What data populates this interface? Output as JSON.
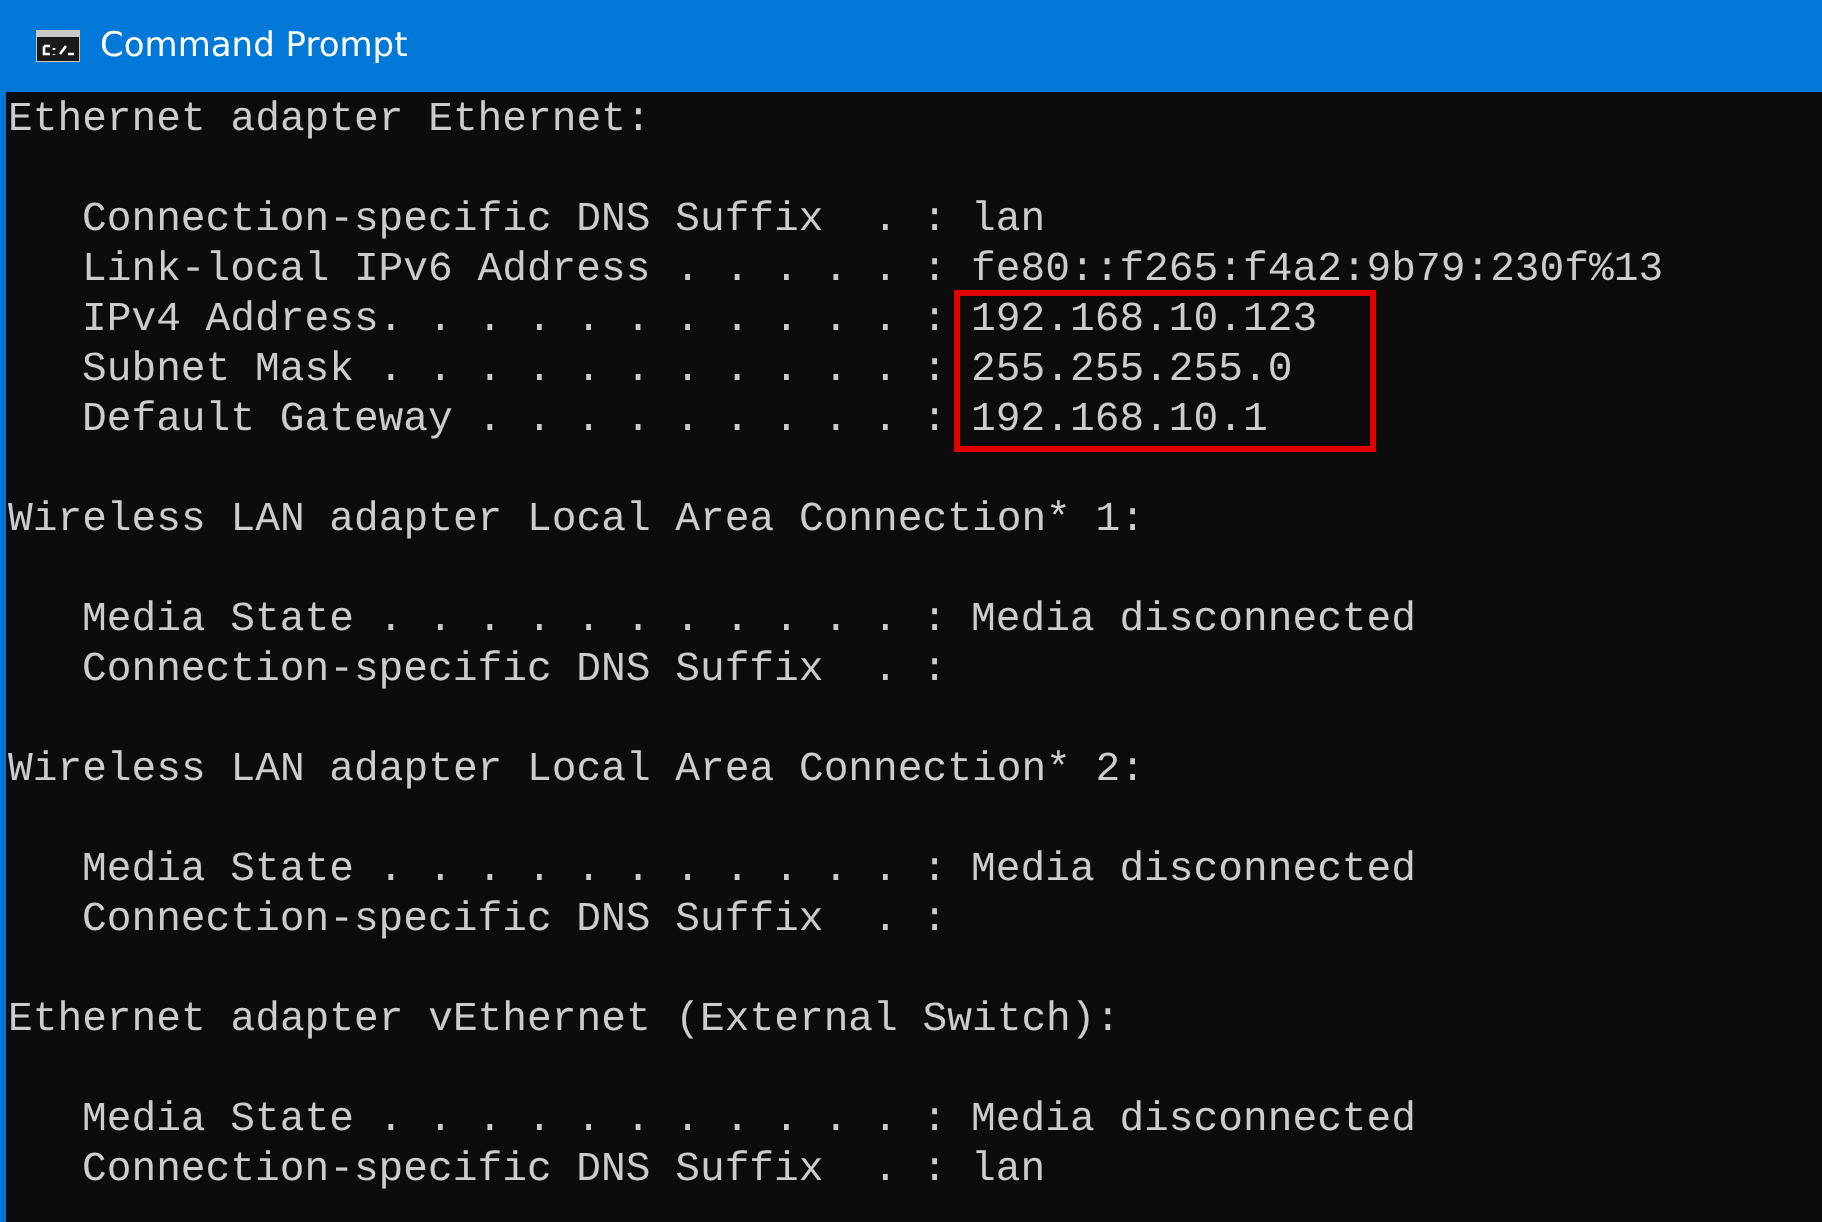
{
  "window": {
    "title": "Command Prompt"
  },
  "sections": [
    {
      "header": "Ethernet adapter Ethernet:",
      "entries": [
        {
          "label": "Connection-specific DNS Suffix  . :",
          "value": "lan",
          "highlighted": false
        },
        {
          "label": "Link-local IPv6 Address . . . . . :",
          "value": "fe80::f265:f4a2:9b79:230f%13",
          "highlighted": false
        },
        {
          "label": "IPv4 Address. . . . . . . . . . . :",
          "value": "192.168.10.123",
          "highlighted": true
        },
        {
          "label": "Subnet Mask . . . . . . . . . . . :",
          "value": "255.255.255.0",
          "highlighted": true
        },
        {
          "label": "Default Gateway . . . . . . . . . :",
          "value": "192.168.10.1",
          "highlighted": true
        }
      ]
    },
    {
      "header": "Wireless LAN adapter Local Area Connection* 1:",
      "entries": [
        {
          "label": "Media State . . . . . . . . . . . :",
          "value": "Media disconnected",
          "highlighted": false
        },
        {
          "label": "Connection-specific DNS Suffix  . :",
          "highlighted": false
        }
      ]
    },
    {
      "header": "Wireless LAN adapter Local Area Connection* 2:",
      "entries": [
        {
          "label": "Media State . . . . . . . . . . . :",
          "value": "Media disconnected",
          "highlighted": false
        },
        {
          "label": "Connection-specific DNS Suffix  . :",
          "highlighted": false
        }
      ]
    },
    {
      "header": "Ethernet adapter vEthernet (External Switch):",
      "entries": [
        {
          "label": "Media State . . . . . . . . . . . :",
          "value": "Media disconnected",
          "highlighted": false
        },
        {
          "label": "Connection-specific DNS Suffix  . :",
          "value": "lan",
          "highlighted": false
        }
      ]
    }
  ]
}
